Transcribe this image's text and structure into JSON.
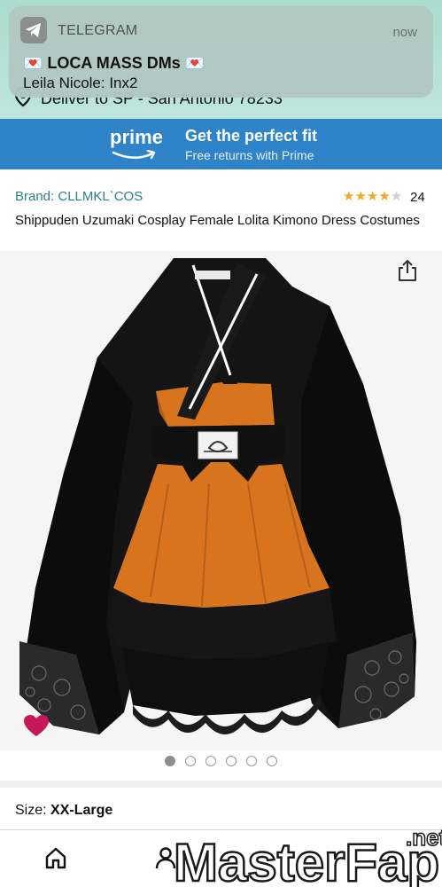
{
  "notification": {
    "app_name": "TELEGRAM",
    "time": "now",
    "title": "💌 LOCA MASS DMs 💌",
    "body": "Leila Nicole: Inx2"
  },
  "deliver": {
    "text": "Deliver to SP - San Antonio 78233"
  },
  "prime_banner": {
    "logo": "prime",
    "headline": "Get the perfect fit",
    "subtext": "Free returns with Prime"
  },
  "product": {
    "brand": "Brand: CLLMKL`COS",
    "rating_stars": 4,
    "rating_count": "24",
    "title": "Shippuden Uzumaki Cosplay Female Lolita Kimono Dress Costumes",
    "tag_text": "CLLMKL`COS",
    "image_count": 6,
    "active_image": 0
  },
  "size": {
    "label": "Size:",
    "value": "XX-Large"
  },
  "watermark": {
    "text": "MasterFap",
    "suffix": ".net"
  },
  "icons": [
    "telegram-icon",
    "location-pin-icon",
    "prime-smile-icon",
    "share-icon",
    "heart-icon",
    "home-icon",
    "user-icon"
  ],
  "colors": {
    "prime_blue": "#2f83c9",
    "brand_link": "#2a7f8f",
    "star": "#f5a623",
    "heart": "#c7175b",
    "kimono_black": "#141414",
    "kimono_orange": "#d9741e"
  }
}
